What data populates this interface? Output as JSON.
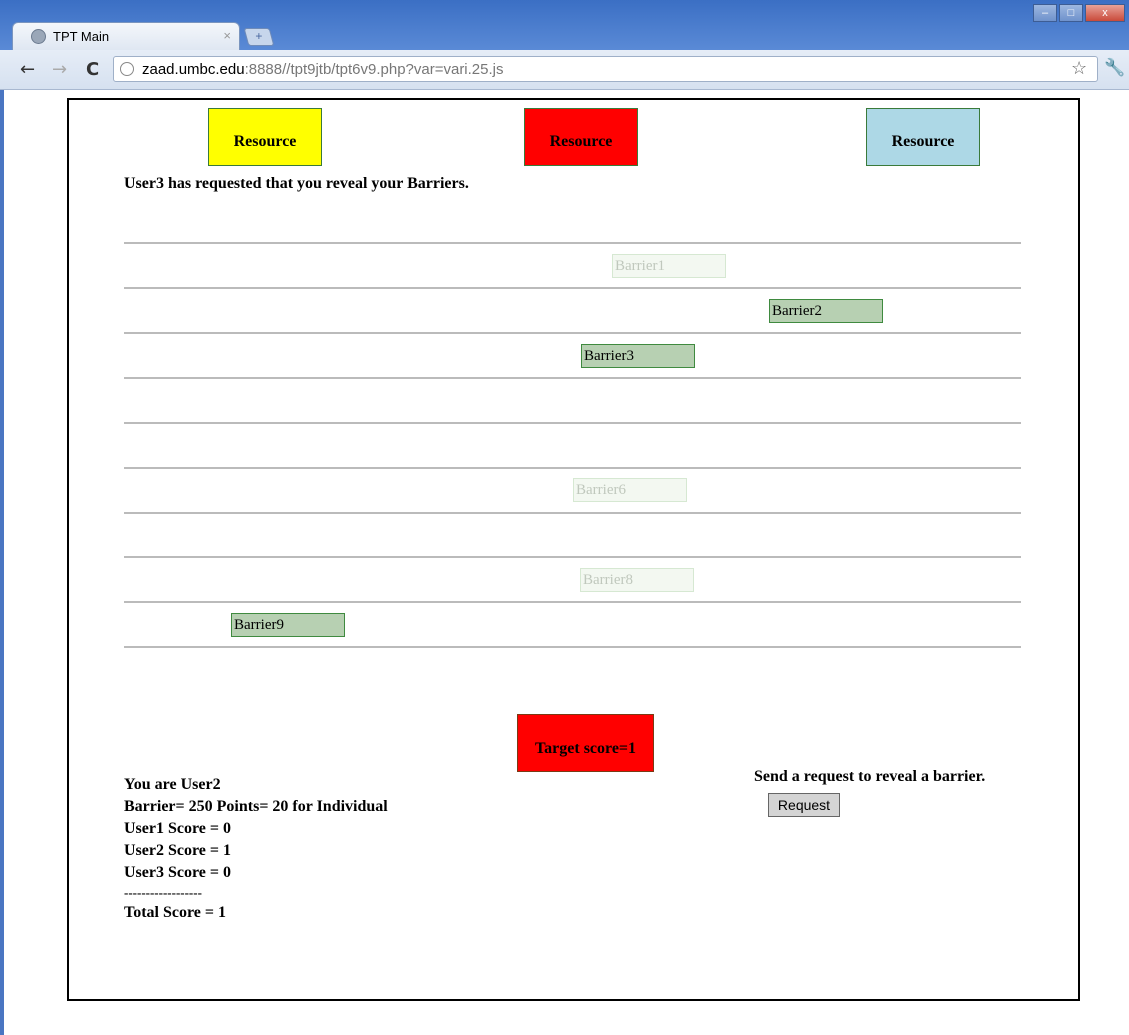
{
  "browser": {
    "tab_title": "TPT Main",
    "tab_close": "×",
    "new_tab": "+",
    "url_host": "zaad.umbc.edu",
    "url_rest": ":8888//tpt9jtb/tpt6v9.php?var=vari.25.js",
    "window_buttons": [
      "–",
      "□",
      "x"
    ]
  },
  "resources": [
    {
      "label": "Resource",
      "color": "#ffff00"
    },
    {
      "label": "Resource",
      "color": "#ff0000"
    },
    {
      "label": "Resource",
      "color": "#add8e6"
    }
  ],
  "message": "User3 has requested that you reveal your Barriers.",
  "barriers": [
    {
      "label": "Barrier1",
      "state": "faint"
    },
    {
      "label": "Barrier2",
      "state": "shown"
    },
    {
      "label": "Barrier3",
      "state": "shown"
    },
    {
      "label": "Barrier6",
      "state": "faint"
    },
    {
      "label": "Barrier8",
      "state": "faint"
    },
    {
      "label": "Barrier9",
      "state": "shown"
    }
  ],
  "target": {
    "label": "Target score=1",
    "color": "#ff0000"
  },
  "scores": {
    "you_are": "You are User2",
    "barrier_points": "Barrier= 250 Points= 20 for Individual",
    "user1": "User1 Score = 0",
    "user2": "User2 Score = 1",
    "user3": "User3 Score = 0",
    "divider": "------------------",
    "total": "Total Score = 1"
  },
  "request": {
    "prompt": "Send a request to reveal a barrier.",
    "button_label": "Request"
  }
}
